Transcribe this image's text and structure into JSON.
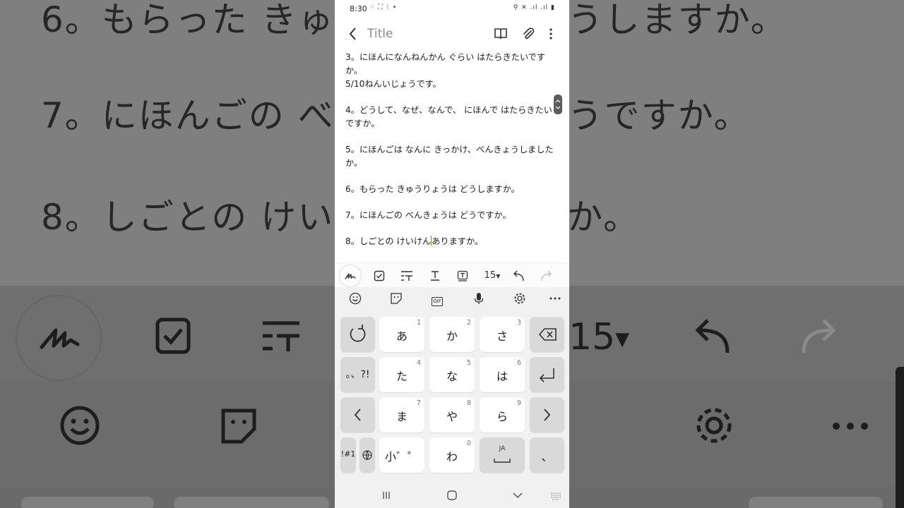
{
  "background": {
    "lines": [
      "6。もらった きゅうりょうは どうしますか。",
      "7。にほんごの べんきょうは どうですか。",
      "8。しごとの けいけん ありますか。"
    ],
    "font_size_value": "15"
  },
  "status": {
    "time": "8:30",
    "left_icons": "⁖ ⛶ ⁝ •",
    "right_icons": "⚲ ✕ .ıl .ıl ▮"
  },
  "appbar": {
    "title": "Title"
  },
  "note": {
    "lines": [
      "3。にほんになんねんかん ぐらい はたらきたいですか。",
      "5/10ねんいじょうです。",
      "",
      "4。どうして、なぜ、なんで、 にほんで はたらきたいですか。",
      "",
      "5。にほんごは なんに きっかけ、べんきょうしましたか。",
      "",
      "6。もらった きゅうりょうは どうしますか。",
      "",
      "7。にほんごの べんきょうは どうですか。",
      ""
    ],
    "last_line_before_cursor": "8。しごとの けいけん",
    "last_line_after_cursor": "ありますか。"
  },
  "format_toolbar": {
    "font_size": "15"
  },
  "keyboard": {
    "top_gif_label": "GIF",
    "rows": [
      [
        {
          "label": "あ",
          "num": "1"
        },
        {
          "label": "か",
          "num": "2"
        },
        {
          "label": "さ",
          "num": "3"
        }
      ],
      [
        {
          "label": "た",
          "num": "4"
        },
        {
          "label": "な",
          "num": "5"
        },
        {
          "label": "は",
          "num": "6"
        }
      ],
      [
        {
          "label": "ま",
          "num": "7"
        },
        {
          "label": "や",
          "num": "8"
        },
        {
          "label": "ら",
          "num": "9"
        }
      ]
    ],
    "punct_key": "。、?!",
    "symbols_key": "!#1",
    "dakuten_key": "小゛゜",
    "wa_key": "わ",
    "wa_num": "0",
    "ja_key": "JA",
    "comma_key": "、"
  }
}
